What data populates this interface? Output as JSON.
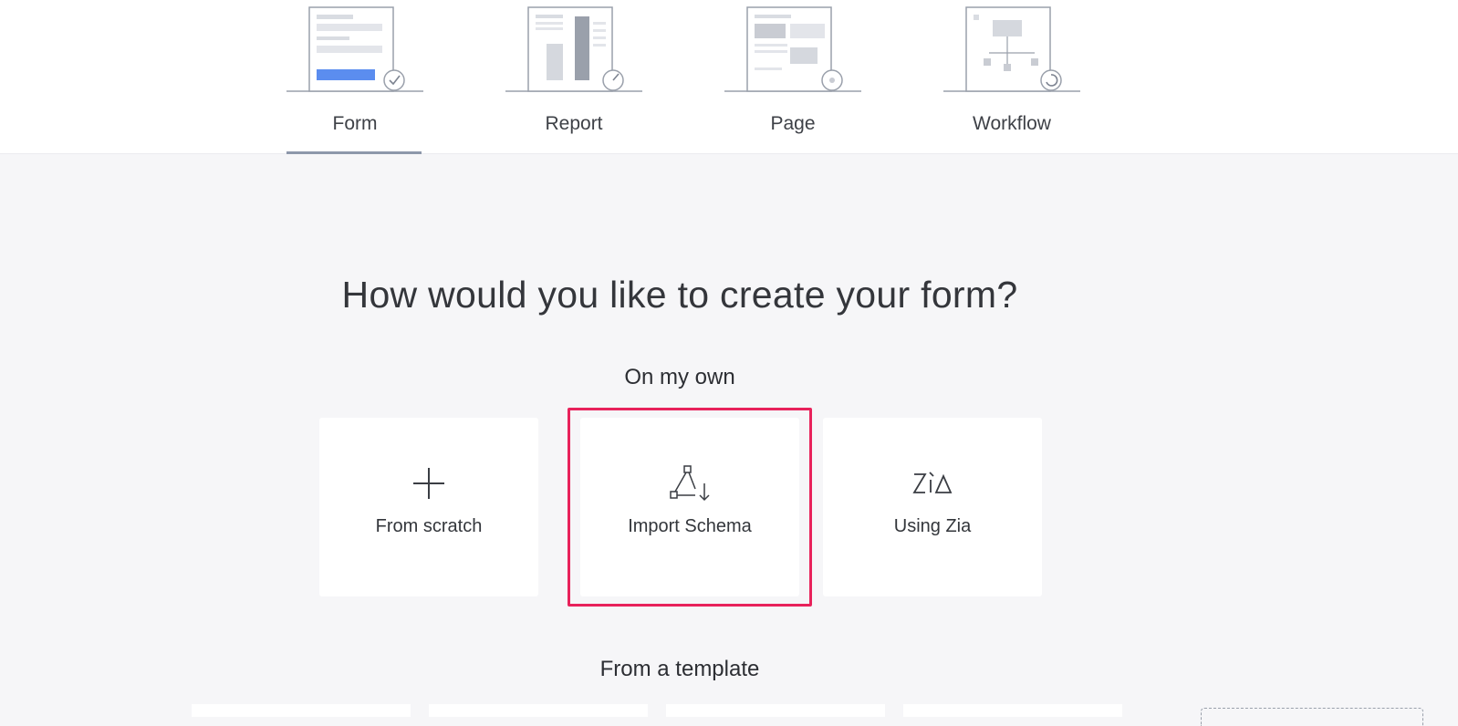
{
  "tabs": [
    {
      "id": "form",
      "label": "Form",
      "active": true
    },
    {
      "id": "report",
      "label": "Report",
      "active": false
    },
    {
      "id": "page",
      "label": "Page",
      "active": false
    },
    {
      "id": "workflow",
      "label": "Workflow",
      "active": false
    }
  ],
  "main": {
    "heading": "How would you like to create your form?",
    "on_my_own": {
      "title": "On my own",
      "options": [
        {
          "label": "From scratch",
          "icon": "plus-icon"
        },
        {
          "label": "Import Schema",
          "icon": "import-schema-icon",
          "highlighted": true
        },
        {
          "label": "Using Zia",
          "icon": "zia-icon"
        }
      ]
    },
    "from_template": {
      "title": "From a template"
    }
  },
  "colors": {
    "accent_tab_button": "#5b8def",
    "highlight_border": "#e8225b",
    "active_tab_underline": "#8d97aa",
    "background": "#f6f6f8"
  }
}
